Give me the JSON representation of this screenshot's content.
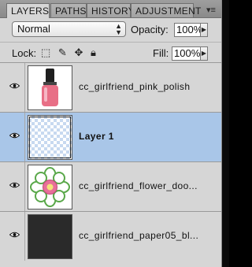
{
  "tabs": [
    {
      "label": "LAYERS",
      "active": true
    },
    {
      "label": "PATHS",
      "active": false
    },
    {
      "label": "HISTORY",
      "active": false
    },
    {
      "label": "ADJUSTMENT",
      "active": false
    }
  ],
  "panel_menu_icon": "panel-menu-icon",
  "blend_mode": {
    "value": "Normal"
  },
  "opacity": {
    "label": "Opacity:",
    "value": "100%"
  },
  "lock": {
    "label": "Lock:",
    "icons": [
      "lock-transparent-icon",
      "lock-paint-icon",
      "lock-position-icon",
      "lock-all-icon"
    ]
  },
  "fill": {
    "label": "Fill:",
    "value": "100%"
  },
  "layers": [
    {
      "name": "cc_girlfriend_pink_polish",
      "thumbnail": "nail-polish-bottle",
      "visible": true,
      "selected": false
    },
    {
      "name": "Layer 1",
      "thumbnail": "transparent",
      "visible": true,
      "selected": true
    },
    {
      "name": "cc_girlfriend_flower_doo...",
      "thumbnail": "flower-doodle",
      "visible": true,
      "selected": false
    },
    {
      "name": "cc_girlfriend_paper05_bl...",
      "thumbnail": "dark-paper",
      "visible": true,
      "selected": false
    }
  ],
  "colors": {
    "selected_row": "#a9c6e8",
    "panel_bg": "#d6d6d6"
  }
}
